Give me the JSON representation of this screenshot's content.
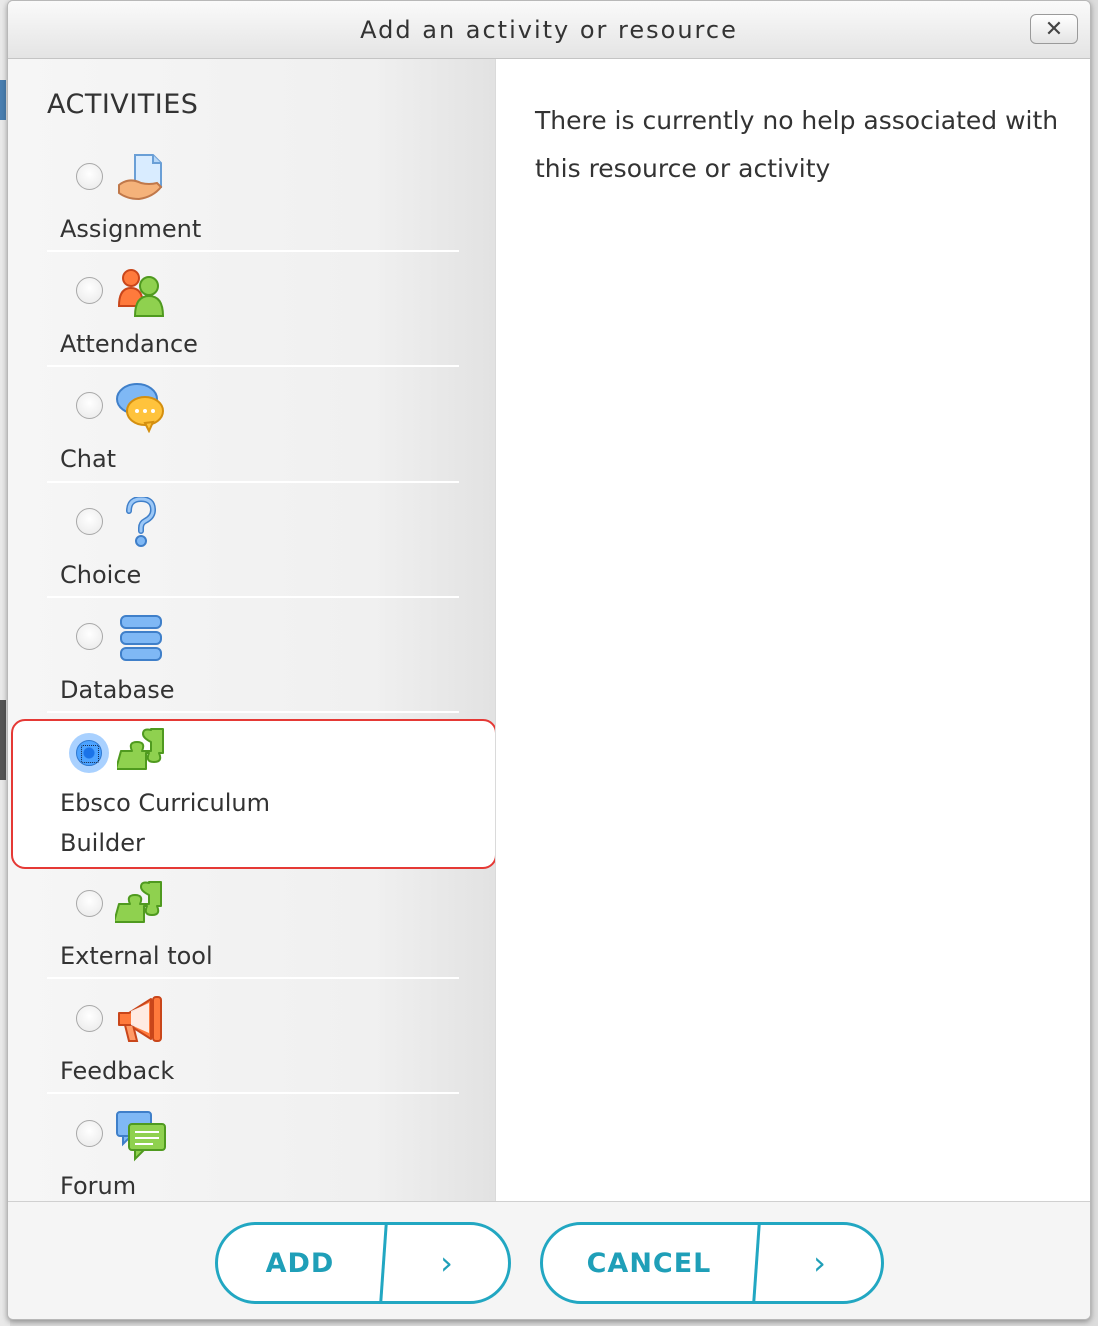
{
  "dialog": {
    "title": "Add an activity or resource",
    "close_label": "✕"
  },
  "activities": {
    "heading": "ACTIVITIES",
    "items": [
      {
        "label": "Assignment",
        "icon": "assignment-icon"
      },
      {
        "label": "Attendance",
        "icon": "attendance-icon"
      },
      {
        "label": "Chat",
        "icon": "chat-icon"
      },
      {
        "label": "Choice",
        "icon": "choice-icon"
      },
      {
        "label": "Database",
        "icon": "database-icon"
      },
      {
        "label_line1": "Ebsco Curriculum",
        "label_line2": "Builder",
        "icon": "puzzle-icon",
        "selected": true
      },
      {
        "label": "External tool",
        "icon": "puzzle-icon"
      },
      {
        "label": "Feedback",
        "icon": "megaphone-icon"
      },
      {
        "label": "Forum",
        "icon": "forum-icon"
      }
    ]
  },
  "help": {
    "text": "There is currently no help associated with this resource or activity"
  },
  "footer": {
    "add_label": "ADD",
    "cancel_label": "CANCEL",
    "arrow": "›"
  },
  "colors": {
    "accent": "#22a7c2",
    "highlight_border": "#e53935",
    "selected_radio": "#4da3ff"
  }
}
